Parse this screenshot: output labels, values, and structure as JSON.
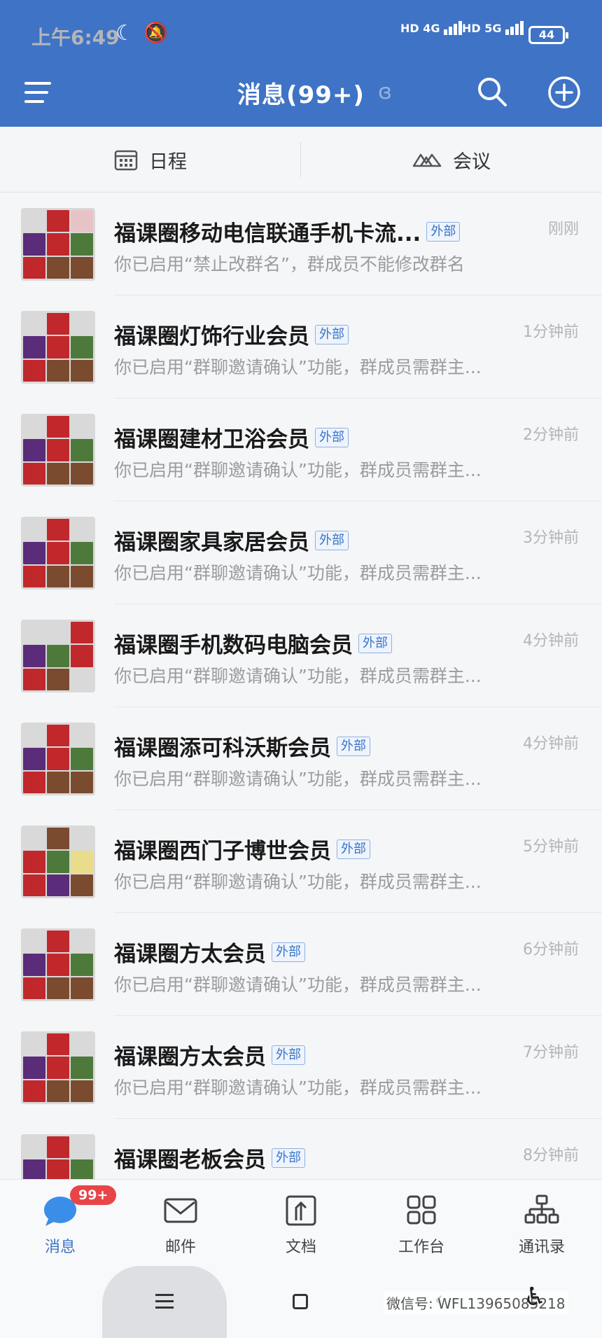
{
  "status_bar": {
    "time": "上午6:49",
    "sim1": "HD 4G",
    "sim2": "HD 5G",
    "battery": "44"
  },
  "header": {
    "title": "消息(99+)",
    "icons": [
      "menu-icon",
      "ear-icon",
      "search-icon",
      "add-icon"
    ],
    "bg_color": "#3f73c5"
  },
  "tabs": {
    "schedule": "日程",
    "meeting": "会议"
  },
  "badge_label": "外部",
  "conversations": [
    {
      "name": "福课圈移动电信联通手机卡流...",
      "time": "刚刚",
      "preview": "你已启用“禁止改群名”，群成员不能修改群名"
    },
    {
      "name": "福课圈灯饰行业会员",
      "time": "1分钟前",
      "preview": "你已启用“群聊邀请确认”功能，群成员需群主..."
    },
    {
      "name": "福课圈建材卫浴会员",
      "time": "2分钟前",
      "preview": "你已启用“群聊邀请确认”功能，群成员需群主..."
    },
    {
      "name": "福课圈家具家居会员",
      "time": "3分钟前",
      "preview": "你已启用“群聊邀请确认”功能，群成员需群主..."
    },
    {
      "name": "福课圈手机数码电脑会员",
      "time": "4分钟前",
      "preview": "你已启用“群聊邀请确认”功能，群成员需群主..."
    },
    {
      "name": "福课圈添可科沃斯会员",
      "time": "4分钟前",
      "preview": "你已启用“群聊邀请确认”功能，群成员需群主..."
    },
    {
      "name": "福课圈西门子博世会员",
      "time": "5分钟前",
      "preview": "你已启用“群聊邀请确认”功能，群成员需群主..."
    },
    {
      "name": "福课圈方太会员",
      "time": "6分钟前",
      "preview": "你已启用“群聊邀请确认”功能，群成员需群主..."
    },
    {
      "name": "福课圈方太会员",
      "time": "7分钟前",
      "preview": "你已启用“群聊邀请确认”功能，群成员需群主..."
    },
    {
      "name": "福课圈老板会员",
      "time": "8分钟前",
      "preview": ""
    }
  ],
  "bottom_nav": {
    "unread_badge": "99+",
    "items": [
      {
        "label": "消息",
        "icon": "chat-bubble-icon",
        "active": true
      },
      {
        "label": "邮件",
        "icon": "mail-icon",
        "active": false
      },
      {
        "label": "文档",
        "icon": "document-icon",
        "active": false
      },
      {
        "label": "工作台",
        "icon": "grid-icon",
        "active": false
      },
      {
        "label": "通讯录",
        "icon": "org-chart-icon",
        "active": false
      }
    ]
  },
  "watermark": "微信号: WFL13965085218"
}
